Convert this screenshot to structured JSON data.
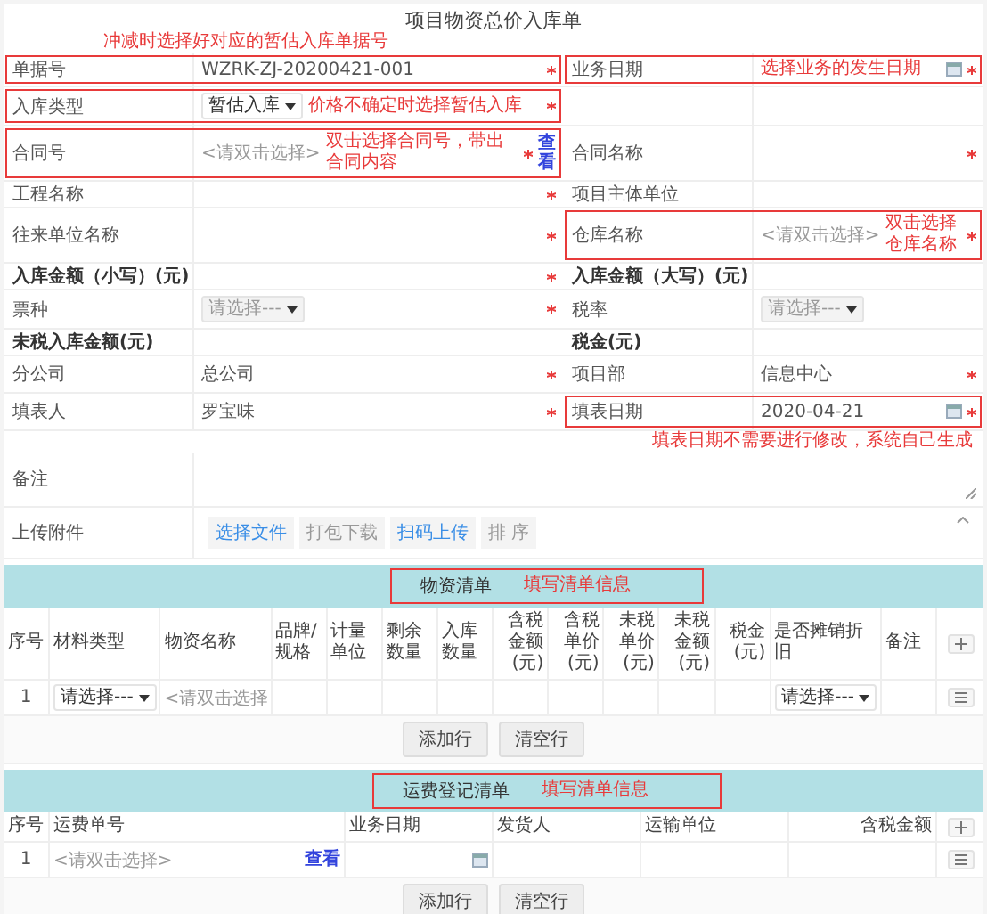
{
  "title": "项目物资总价入库单",
  "form": [
    {
      "kind": "note_left",
      "text": "冲减时选择好对应的暂估入库单据号"
    },
    {
      "kind": "fields",
      "cells": [
        {
          "label": "单据号",
          "kind": "text",
          "value": "WZRK-ZJ-20200421-001",
          "bold": false,
          "required": true,
          "highlighted": true
        },
        {
          "label": "业务日期",
          "kind": "date",
          "note": "选择业务的发生日期",
          "bold": false,
          "required": true,
          "highlighted": true
        }
      ]
    },
    {
      "kind": "fields",
      "cells": [
        {
          "label": "入库类型",
          "kind": "select",
          "value": "暂估入库",
          "note": "价格不确定时选择暂估入库",
          "bold": false,
          "required": true,
          "highlighted": true
        },
        {
          "kind": "blank"
        }
      ]
    },
    {
      "kind": "fields",
      "cells": [
        {
          "label": "合同号",
          "kind": "picker",
          "placeholder": "<请双击选择>",
          "note": "双击选择合同号，带出合同内容",
          "link": "查看",
          "bold": false,
          "required": true,
          "highlighted": true
        },
        {
          "label": "合同名称",
          "kind": "empty",
          "bold": false,
          "required": true,
          "highlighted": false
        }
      ]
    },
    {
      "kind": "fields",
      "cells": [
        {
          "label": "工程名称",
          "kind": "empty",
          "bold": false,
          "required": true,
          "highlighted": false
        },
        {
          "label": "项目主体单位",
          "kind": "empty",
          "bold": false,
          "required": false,
          "highlighted": false
        }
      ]
    },
    {
      "kind": "fields",
      "cells": [
        {
          "label": "往来单位名称",
          "kind": "empty",
          "bold": false,
          "required": true,
          "highlighted": false
        },
        {
          "label": "仓库名称",
          "kind": "picker",
          "placeholder": "<请双击选择>",
          "note": "双击选择仓库名称",
          "bold": false,
          "required": true,
          "highlighted": true
        }
      ]
    },
    {
      "kind": "fields",
      "cells": [
        {
          "label": "入库金额（小写）(元)",
          "bold": true,
          "kind": "empty",
          "required": true,
          "highlighted": false
        },
        {
          "label": "入库金额（大写）(元)",
          "bold": true,
          "kind": "empty",
          "required": false,
          "highlighted": false
        }
      ]
    },
    {
      "kind": "fields",
      "cells": [
        {
          "label": "票种",
          "kind": "select",
          "value": "请选择---",
          "disabled": true,
          "bold": false,
          "required": true,
          "highlighted": false
        },
        {
          "label": "税率",
          "kind": "select",
          "value": "请选择---",
          "disabled": true,
          "bold": false,
          "required": false,
          "highlighted": false
        }
      ]
    },
    {
      "kind": "fields",
      "cells": [
        {
          "label": "未税入库金额(元)",
          "bold": true,
          "kind": "empty",
          "required": false,
          "highlighted": false
        },
        {
          "label": "税金(元)",
          "bold": true,
          "kind": "empty",
          "required": false,
          "highlighted": false
        }
      ]
    },
    {
      "kind": "fields",
      "cells": [
        {
          "label": "分公司",
          "kind": "text",
          "value": "总公司",
          "bold": false,
          "required": true,
          "highlighted": false
        },
        {
          "label": "项目部",
          "kind": "text",
          "value": "信息中心",
          "bold": false,
          "required": true,
          "highlighted": false
        }
      ]
    },
    {
      "kind": "fields",
      "cells": [
        {
          "label": "填表人",
          "kind": "text",
          "value": "罗宝味",
          "bold": false,
          "required": true,
          "highlighted": false
        },
        {
          "label": "填表日期",
          "kind": "date",
          "value": "2020-04-21",
          "bold": false,
          "required": true,
          "highlighted": true
        }
      ]
    },
    {
      "kind": "note_right",
      "text": "填表日期不需要进行修改，系统自己生成"
    },
    {
      "kind": "textarea",
      "label": "备注"
    },
    {
      "kind": "upload",
      "label": "上传附件",
      "buttons": [
        {
          "label": "选择文件",
          "enabled": true
        },
        {
          "label": "打包下载",
          "enabled": false
        },
        {
          "label": "扫码上传",
          "enabled": true
        },
        {
          "label": "排 序",
          "enabled": false
        }
      ]
    }
  ],
  "sections": [
    {
      "title": "物资清单",
      "note": "填写清单信息",
      "columns": [
        {
          "label": "序号",
          "kind": "index"
        },
        {
          "label": "材料类型",
          "kind": "text"
        },
        {
          "label": "物资名称",
          "kind": "text"
        },
        {
          "label": "品牌/规格",
          "kind": "text"
        },
        {
          "label": "计量单位",
          "kind": "text"
        },
        {
          "label": "剩余数量",
          "kind": "text"
        },
        {
          "label": "入库数量",
          "kind": "text"
        },
        {
          "label": "含税金额(元)",
          "kind": "amount"
        },
        {
          "label": "含税单价(元)",
          "kind": "amount"
        },
        {
          "label": "未税单价(元)",
          "kind": "amount"
        },
        {
          "label": "未税金额(元)",
          "kind": "amount"
        },
        {
          "label": "税金(元)",
          "kind": "amount"
        },
        {
          "label": "是否摊销折旧",
          "kind": "text"
        },
        {
          "label": "备注",
          "kind": "text"
        }
      ],
      "rows": [
        {
          "cells": [
            {
              "kind": "text",
              "value": "1"
            },
            {
              "kind": "select",
              "value": "请选择---"
            },
            {
              "kind": "picker",
              "placeholder": "<请双击选择"
            },
            {
              "kind": "empty"
            },
            {
              "kind": "empty"
            },
            {
              "kind": "empty"
            },
            {
              "kind": "empty"
            },
            {
              "kind": "empty"
            },
            {
              "kind": "empty"
            },
            {
              "kind": "empty"
            },
            {
              "kind": "empty"
            },
            {
              "kind": "empty"
            },
            {
              "kind": "select",
              "value": "请选择---"
            },
            {
              "kind": "empty"
            }
          ]
        }
      ],
      "buttons": [
        "添加行",
        "清空行"
      ]
    },
    {
      "title": "运费登记清单",
      "note": "填写清单信息",
      "columns": [
        {
          "label": "序号",
          "kind": "index"
        },
        {
          "label": "运费单号",
          "kind": "text"
        },
        {
          "label": "业务日期",
          "kind": "text"
        },
        {
          "label": "发货人",
          "kind": "text"
        },
        {
          "label": "运输单位",
          "kind": "text"
        },
        {
          "label": "含税金额",
          "kind": "amount"
        }
      ],
      "rows": [
        {
          "cells": [
            {
              "kind": "text",
              "value": "1"
            },
            {
              "kind": "picker",
              "placeholder": "<请双击选择>",
              "link": "查看"
            },
            {
              "kind": "date"
            },
            {
              "kind": "empty"
            },
            {
              "kind": "empty"
            },
            {
              "kind": "empty"
            }
          ]
        }
      ],
      "buttons": [
        "添加行",
        "清空行"
      ]
    }
  ]
}
